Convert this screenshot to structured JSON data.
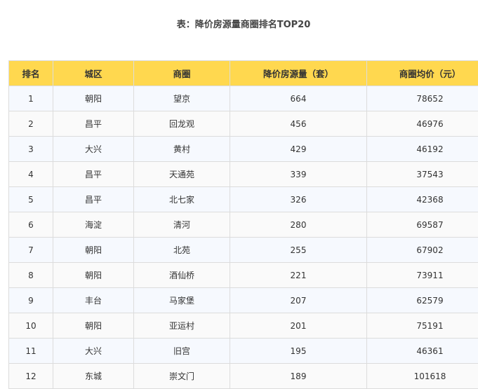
{
  "title": "表：降价房源量商圈排名TOP20",
  "columns": [
    "排名",
    "城区",
    "商圈",
    "降价房源量（套）",
    "商圈均价（元）"
  ],
  "rows": [
    [
      "1",
      "朝阳",
      "望京",
      "664",
      "78652"
    ],
    [
      "2",
      "昌平",
      "回龙观",
      "456",
      "46976"
    ],
    [
      "3",
      "大兴",
      "黄村",
      "429",
      "46192"
    ],
    [
      "4",
      "昌平",
      "天通苑",
      "339",
      "37543"
    ],
    [
      "5",
      "昌平",
      "北七家",
      "326",
      "42368"
    ],
    [
      "6",
      "海淀",
      "清河",
      "280",
      "69587"
    ],
    [
      "7",
      "朝阳",
      "北苑",
      "255",
      "67902"
    ],
    [
      "8",
      "朝阳",
      "酒仙桥",
      "221",
      "73911"
    ],
    [
      "9",
      "丰台",
      "马家堡",
      "207",
      "62579"
    ],
    [
      "10",
      "朝阳",
      "亚运村",
      "201",
      "75191"
    ],
    [
      "11",
      "大兴",
      "旧宫",
      "195",
      "46361"
    ],
    [
      "12",
      "东城",
      "崇文门",
      "189",
      "101618"
    ]
  ]
}
